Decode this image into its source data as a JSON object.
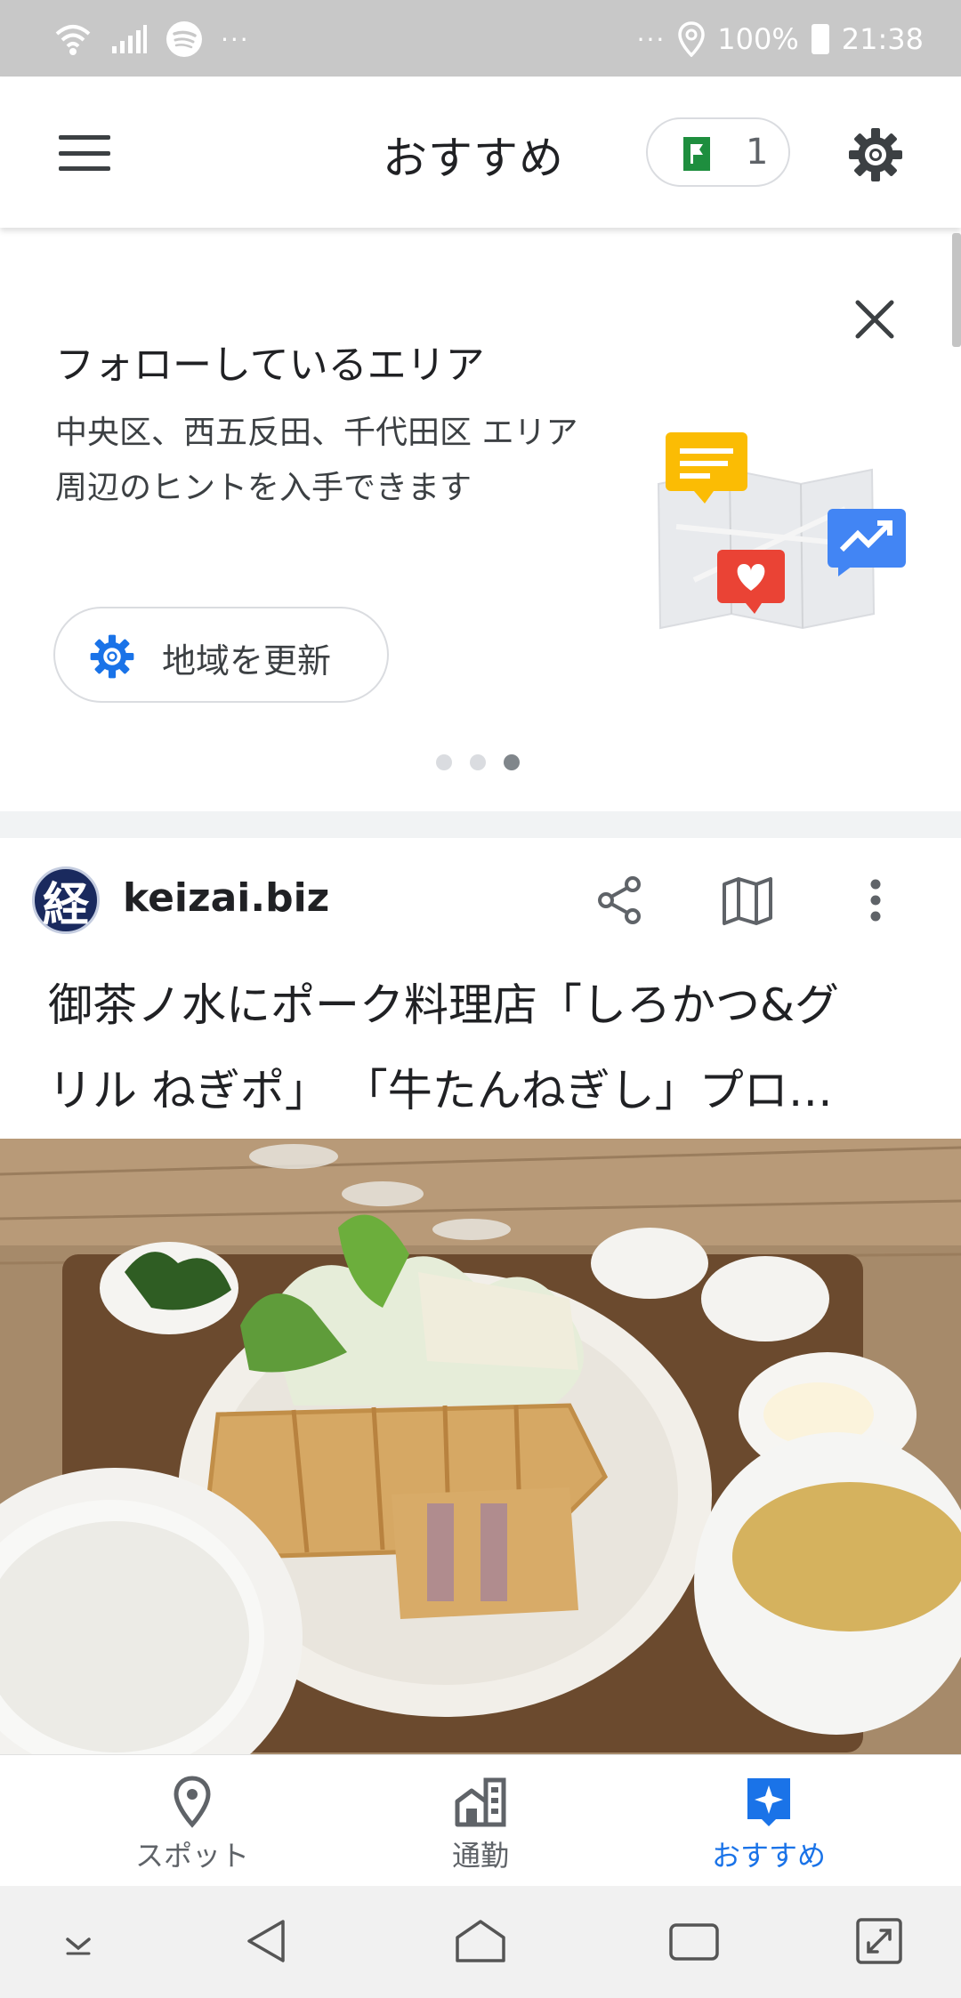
{
  "status_bar": {
    "battery": "100%",
    "time": "21:38",
    "left_more": "···",
    "right_more": "···"
  },
  "app_bar": {
    "title": "おすすめ",
    "saved_count": "1"
  },
  "follow_card": {
    "title": "フォローしているエリア",
    "description": "中央区、西五反田、千代田区 エリア周辺のヒントを入手できます",
    "update_button": "地域を更新",
    "page_dots": 3,
    "active_dot": 3
  },
  "article": {
    "publisher_logo_text": "経",
    "publisher": "keizai.biz",
    "headline_line1": "御茶ノ水にポーク料理店「しろかつ&グ",
    "headline_line2": "リル ねぎポ」 「牛たんねぎし」プロ…"
  },
  "bottom_nav": {
    "items": [
      {
        "label": "スポット",
        "icon": "location-pin-icon",
        "active": false
      },
      {
        "label": "通勤",
        "icon": "commute-building-icon",
        "active": false
      },
      {
        "label": "おすすめ",
        "icon": "sparkle-icon",
        "active": true
      }
    ]
  },
  "colors": {
    "accent": "#1a73e8",
    "flag_green": "#1e8e3e",
    "status_bar": "#c8c8c8",
    "publisher_logo": "#1a2a5e"
  }
}
